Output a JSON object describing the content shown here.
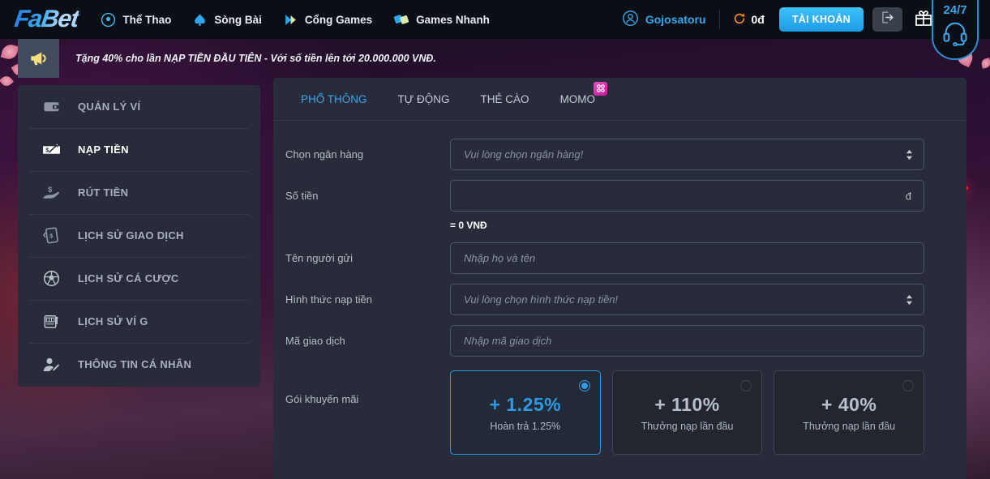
{
  "header": {
    "logo_text": "FaBet",
    "nav": [
      {
        "label": "Thể Thao",
        "icon": "soccer-ball-icon"
      },
      {
        "label": "Sòng Bài",
        "icon": "spade-icon"
      },
      {
        "label": "Cổng Games",
        "icon": "play-triangle-icon"
      },
      {
        "label": "Games Nhanh",
        "icon": "dice-icon"
      }
    ],
    "username": "Gojosatoru",
    "user_icon": "user-circle-icon",
    "balance": "0đ",
    "refresh_icon": "refresh-icon",
    "account_button": "TÀI KHOẢN",
    "logout_icon": "logout-icon",
    "gift_icon": "gift-icon",
    "support": {
      "label": "24/7",
      "icon": "headset-icon"
    },
    "accent_blue": "#35a8ec",
    "bar_background": "#0b0e15"
  },
  "announcement": {
    "icon": "megaphone-icon",
    "text": "Tặng 40% cho lần NẠP TIỀN ĐẦU TIÊN - Với số tiền lên tới 20.000.000 VNĐ."
  },
  "sidebar": {
    "items": [
      {
        "label": "QUẢN LÝ VÍ",
        "icon": "wallet-icon",
        "active": false
      },
      {
        "label": "NẠP TIỀN",
        "icon": "deposit-cash-icon",
        "active": true
      },
      {
        "label": "RÚT TIỀN",
        "icon": "withdraw-hand-icon",
        "active": false
      },
      {
        "label": "LỊCH SỬ GIAO DỊCH",
        "icon": "transaction-history-icon",
        "active": false
      },
      {
        "label": "LỊCH SỬ CÁ CƯỢC",
        "icon": "soccer-ball-icon",
        "active": false
      },
      {
        "label": "LỊCH SỬ VÍ G",
        "icon": "slot-machine-icon",
        "active": false
      },
      {
        "label": "THÔNG TIN CÁ NHÂN",
        "icon": "user-edit-icon",
        "active": false
      }
    ]
  },
  "main": {
    "tabs": [
      {
        "label": "PHỔ THÔNG",
        "active": true,
        "badge": false
      },
      {
        "label": "TỰ ĐỘNG",
        "active": false,
        "badge": false
      },
      {
        "label": "THẺ CÀO",
        "active": false,
        "badge": false
      },
      {
        "label": "MOMO",
        "active": false,
        "badge": true,
        "badge_icon": "momo-badge-icon"
      }
    ],
    "fields": [
      {
        "label": "Chọn ngân hàng",
        "type": "select",
        "value": "",
        "placeholder": "Vui lòng chọn ngân hàng!"
      },
      {
        "label": "Số tiền",
        "type": "text",
        "value": "",
        "placeholder": "",
        "suffix": "đ"
      },
      {
        "label": "Tên người gửi",
        "type": "text",
        "value": "",
        "placeholder": "Nhập họ và tên"
      },
      {
        "label": "Hình thức nạp tiền",
        "type": "select",
        "value": "",
        "placeholder": "Vui lòng chọn hình thức nạp tiền!"
      },
      {
        "label": "Mã giao dịch",
        "type": "text",
        "value": "",
        "placeholder": "Nhập mã giao dịch"
      }
    ],
    "amount_hint": "= 0 VNĐ",
    "promo_label": "Gói khuyến mãi",
    "promos": [
      {
        "amount": "+ 1.25%",
        "desc": "Hoàn trả 1.25%",
        "selected": true
      },
      {
        "amount": "+ 110%",
        "desc": "Thưởng nạp lần đầu",
        "selected": false
      },
      {
        "amount": "+ 40%",
        "desc": "Thưởng nạp lần đầu",
        "selected": false
      }
    ]
  }
}
